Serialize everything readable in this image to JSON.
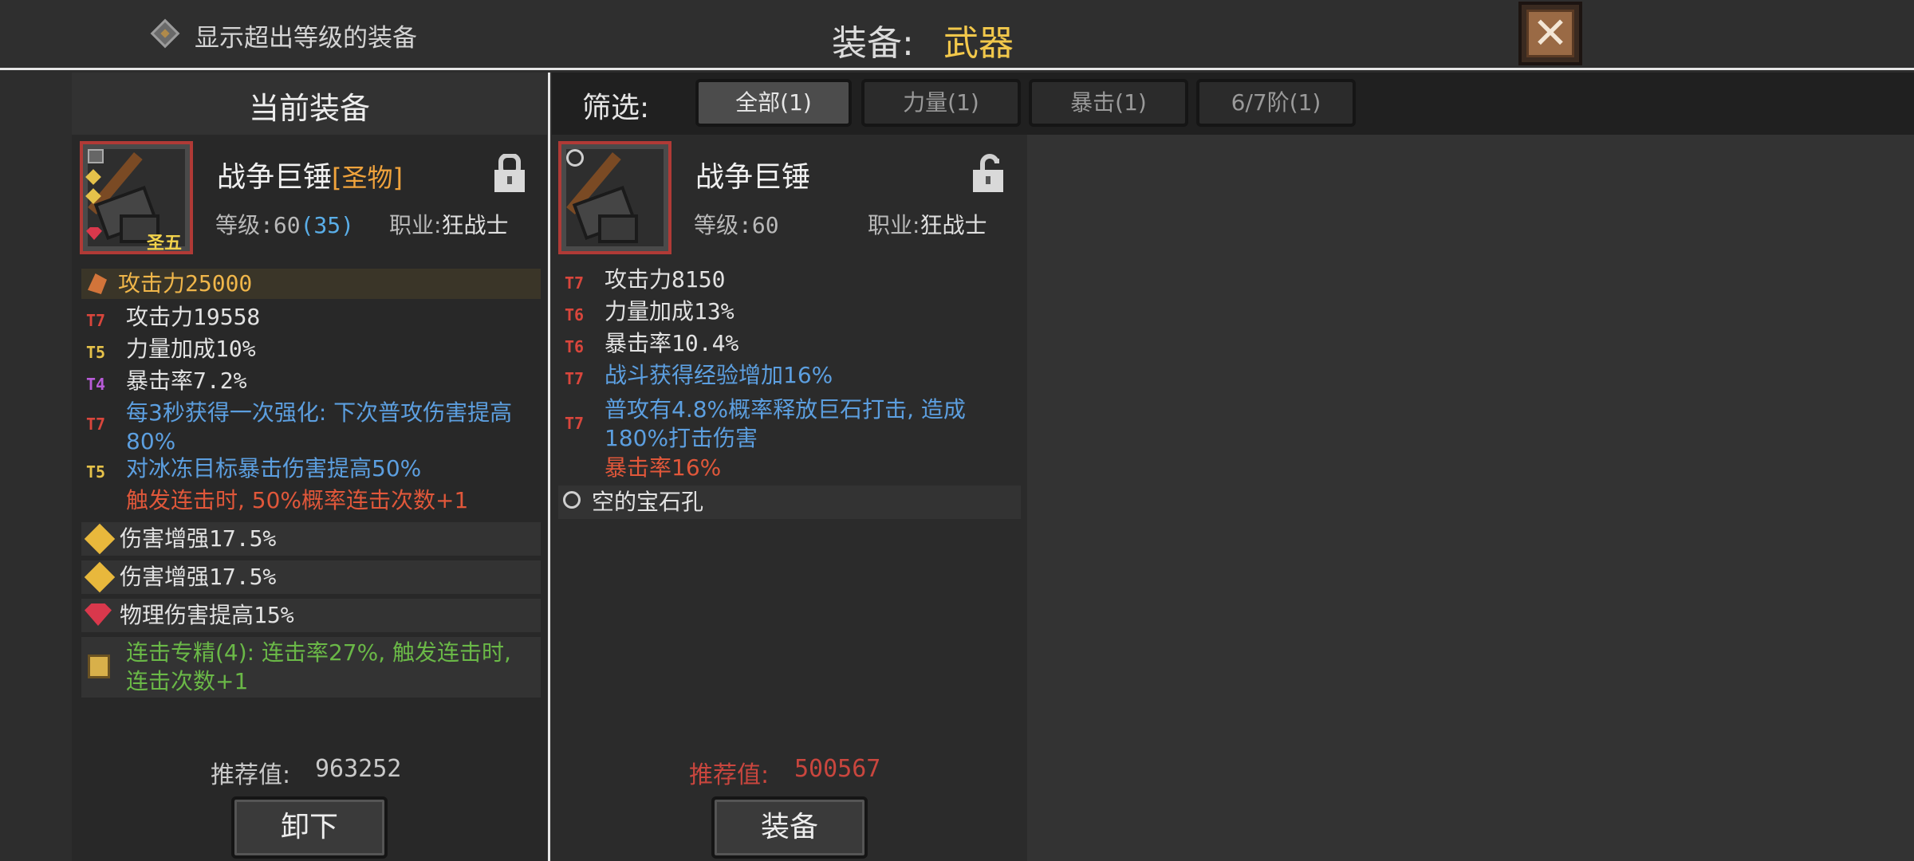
{
  "topbar": {
    "toggle_label": "显示超出等级的装备",
    "title_label": "装备:",
    "title_value": "武器",
    "close_symbol": "✕"
  },
  "current": {
    "header": "当前装备",
    "item": {
      "name": "战争巨锤",
      "tag": "[圣物]",
      "badge": "圣五",
      "level_label": "等级:",
      "level": "60",
      "level_bonus": "(35)",
      "class_label": "职业:",
      "class_name": "狂战士"
    },
    "main_stat": "攻击力25000",
    "stats": [
      {
        "tier": "T7",
        "text": "攻击力19558"
      },
      {
        "tier": "T5",
        "text": "力量加成10%"
      },
      {
        "tier": "T4",
        "text": "暴击率7.2%"
      },
      {
        "tier": "T7",
        "text": "每3秒获得一次强化: 下次普攻伤害提高80%"
      },
      {
        "tier": "T5",
        "text": "对冰冻目标暴击伤害提高50%"
      }
    ],
    "extra_effect": "触发连击时, 50%概率连击次数+1",
    "gems": [
      {
        "icon": "yellow-gem-icon",
        "text": "伤害增强17.5%"
      },
      {
        "icon": "yellow-gem-icon",
        "text": "伤害增强17.5%"
      },
      {
        "icon": "red-gem-icon",
        "text": "物理伤害提高15%"
      }
    ],
    "set_bonus": "连击专精(4): 连击率27%, 触发连击时, 连击次数+1",
    "recommend_label": "推荐值:",
    "recommend_value": "963252",
    "action": "卸下"
  },
  "filters": {
    "label": "筛选:",
    "chips": [
      "全部(1)",
      "力量(1)",
      "暴击(1)",
      "6/7阶(1)"
    ],
    "active_index": 0
  },
  "candidate": {
    "item": {
      "name": "战争巨锤",
      "level_label": "等级:",
      "level": "60",
      "class_label": "职业:",
      "class_name": "狂战士"
    },
    "stats": [
      {
        "tier": "T7",
        "text": "攻击力8150"
      },
      {
        "tier": "T6",
        "text": "力量加成13%"
      },
      {
        "tier": "T6",
        "text": "暴击率10.4%"
      },
      {
        "tier": "T7",
        "text": "战斗获得经验增加16%"
      },
      {
        "tier": "T7",
        "text": "普攻有4.8%概率释放巨石打击, 造成180%打击伤害"
      }
    ],
    "extra_effect": "暴击率16%",
    "socket": "空的宝石孔",
    "recommend_label": "推荐值:",
    "recommend_value": "500567",
    "action": "装备"
  },
  "colors": {
    "gold": "#f2c84b",
    "tier_red": "#d9463c",
    "tier_yellow": "#e6c24a",
    "tier_purple": "#b85bd8",
    "skill_blue": "#5c9fe0",
    "effect_red": "#e0573a",
    "set_green": "#6ab847",
    "recommend_red": "#c9463e"
  }
}
